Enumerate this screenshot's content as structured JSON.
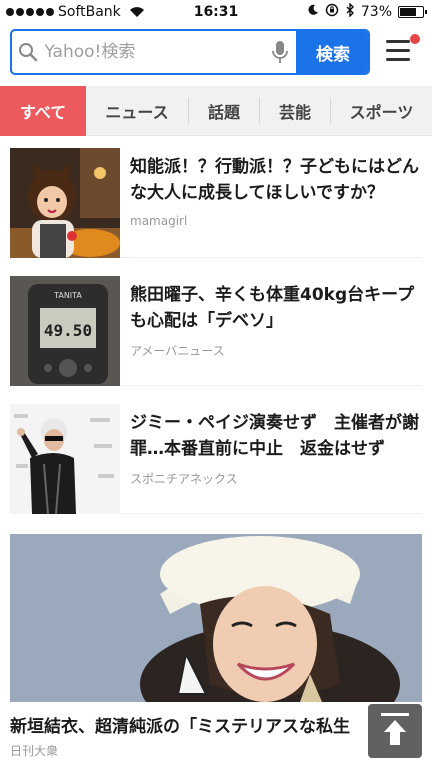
{
  "status": {
    "carrier": "SoftBank",
    "time": "16:31",
    "battery_percent": "73%",
    "battery_level": 0.73
  },
  "search": {
    "placeholder": "Yahoo!検索",
    "button_label": "検索"
  },
  "tabs": [
    {
      "label": "すべて",
      "active": true
    },
    {
      "label": "ニュース"
    },
    {
      "label": "話題"
    },
    {
      "label": "芸能"
    },
    {
      "label": "スポーツ"
    }
  ],
  "articles": [
    {
      "title": "知能派！？行動派！？子どもにはどんな大人に成長してほしいですか？",
      "source": "mamagirl"
    },
    {
      "title": "熊田曜子、辛くも体重40kg台キープも心配は「デベソ」",
      "source": "アメーバニュース",
      "scale_brand": "TANITA",
      "scale_reading": "49.50"
    },
    {
      "title": "ジミー・ペイジ演奏せず　主催者が謝罪…本番直前に中止　返金はせず",
      "source": "スポニチアネックス"
    }
  ],
  "featured": {
    "title": "新垣結衣、超清純派の「ミステリアスな私生",
    "source": "日刊大衆"
  },
  "colors": {
    "accent_blue": "#1a73e8",
    "active_tab": "#ec5a5e",
    "notification_dot": "#e64545"
  }
}
